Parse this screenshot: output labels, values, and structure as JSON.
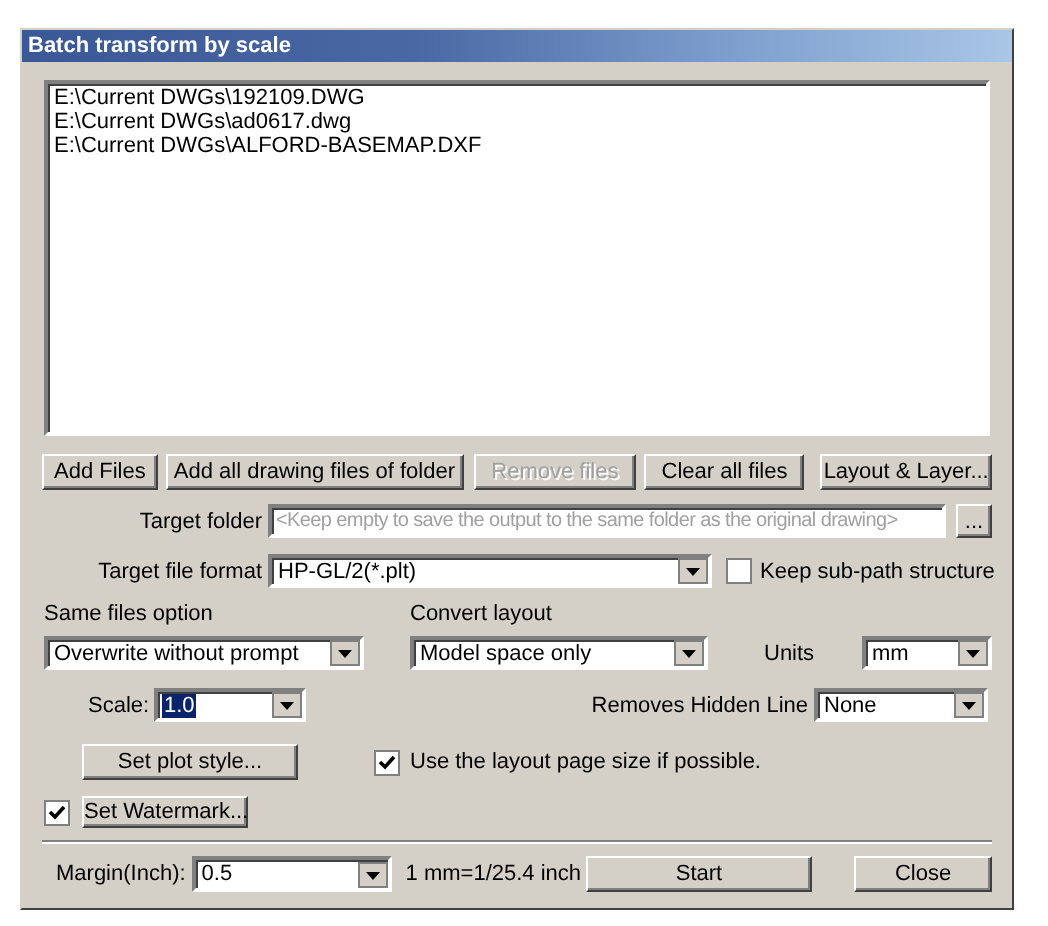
{
  "window": {
    "title": "Batch transform by scale"
  },
  "file_list": [
    "E:\\Current DWGs\\192109.DWG",
    "E:\\Current DWGs\\ad0617.dwg",
    "E:\\Current DWGs\\ALFORD-BASEMAP.DXF"
  ],
  "buttons": [
    {
      "label": "Add Files",
      "disabled": false
    },
    {
      "label": "Add all drawing files of folder",
      "disabled": false
    },
    {
      "label": "Remove files",
      "disabled": true
    },
    {
      "label": "Clear all files",
      "disabled": false
    },
    {
      "label": "Layout & Layer...",
      "disabled": false
    }
  ],
  "target_folder": {
    "label": "Target folder",
    "placeholder": "<Keep empty to save the output to the same folder as the original drawing>",
    "browse_button": "..."
  },
  "target_format": {
    "label": "Target file format",
    "value": "HP-GL/2(*.plt)"
  },
  "keep_subpath": {
    "label": "Keep sub-path structure",
    "checked": false
  },
  "same_files": {
    "label": "Same files option",
    "value": "Overwrite without prompt"
  },
  "convert_layout": {
    "label": "Convert layout",
    "value": "Model space only"
  },
  "units": {
    "label": "Units",
    "value": "mm"
  },
  "scale": {
    "label": "Scale:",
    "value": "1.0",
    "selected": true
  },
  "hidden_line": {
    "label": "Removes Hidden Line",
    "value": "None"
  },
  "plot_style_button": "Set plot style...",
  "use_layout_page_size": {
    "label": "Use the layout page size if possible.",
    "checked": true
  },
  "watermark": {
    "checked": true,
    "button": "Set Watermark..."
  },
  "margin": {
    "label": "Margin(Inch):",
    "value": "0.5"
  },
  "conversion_note": "1 mm=1/25.4 inch",
  "start_button": "Start",
  "close_button": "Close"
}
